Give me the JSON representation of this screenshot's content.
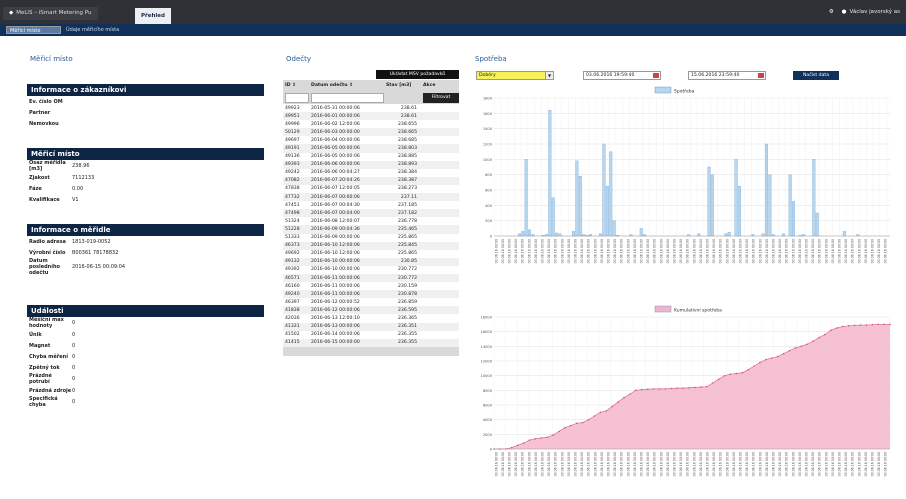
{
  "topbar": {
    "app_title": "MeLiS – iSmart Metering Pu",
    "active_tab": "Přehled",
    "user": "Václav javorský as"
  },
  "subbar": {
    "crumbs": [
      "Měřicí místo",
      "Údaje měřicího místa"
    ]
  },
  "left": {
    "title": "Měřicí místo",
    "boxes": [
      {
        "header": "Informace o zákazníkovi",
        "rows": [
          {
            "k": "Ev. číslo OM",
            "v": ""
          },
          {
            "k": "Partner",
            "v": ""
          },
          {
            "k": "Nemovkou",
            "v": ""
          }
        ]
      },
      {
        "header": "Měřicí místo",
        "rows": [
          {
            "k": "Osaz měřidla [m3]",
            "v": "238.96"
          },
          {
            "k": "Zjakost",
            "v": "7112133"
          },
          {
            "k": "Fáze",
            "v": "0.00"
          },
          {
            "k": "Kvalifikace",
            "v": "V1"
          }
        ]
      },
      {
        "header": "Informace o měřidle",
        "rows": [
          {
            "k": "Radio adresa",
            "v": "1813-019-0052"
          },
          {
            "k": "Výrobní číslo",
            "v": "B00361 78178832"
          },
          {
            "k": "Datum posledního odečtu",
            "v": "2016-06-15 00:09:04"
          }
        ]
      },
      {
        "header": "Události",
        "rows": [
          {
            "k": "Měšiční max hodnoty",
            "v": "0"
          },
          {
            "k": "Únik",
            "v": "0"
          },
          {
            "k": "Magnet",
            "v": "0"
          },
          {
            "k": "Chyba měření",
            "v": "0"
          },
          {
            "k": "Zpětný tok",
            "v": "0"
          },
          {
            "k": "Prázdné potrubí",
            "v": "0"
          },
          {
            "k": "Prázdná zdroje",
            "v": "0"
          },
          {
            "k": "Specifická chyba",
            "v": "0"
          }
        ]
      }
    ]
  },
  "table": {
    "title": "Odečty",
    "collapse_label": "Ukládat MSV požadavků",
    "headers": [
      "ID ⇕",
      "Datum odečtu ⇕",
      "Stav [m3]",
      "Akce"
    ],
    "filter_button": "Filtrovat",
    "rows": [
      [
        "49923",
        "2016-05-31 00:00:06",
        "238.61"
      ],
      [
        "49951",
        "2016-06-01 00:00:06",
        "238.61"
      ],
      [
        "49996",
        "2016-06-02 12:00:06",
        "238.655"
      ],
      [
        "50129",
        "2016-06-03 00:00:00",
        "238.665"
      ],
      [
        "49697",
        "2016-06-04 00:00:06",
        "238.685"
      ],
      [
        "49191",
        "2016-06-05 00:00:06",
        "238.803"
      ],
      [
        "49136",
        "2016-06-05 00:00:06",
        "238.885"
      ],
      [
        "49393",
        "2016-06-06 00:00:06",
        "238.893"
      ],
      [
        "49242",
        "2016-06-06 00:04:27",
        "238.384"
      ],
      [
        "47082",
        "2016-06-07 20:04:26",
        "238.387"
      ],
      [
        "47838",
        "2016-06-07 12:00:05",
        "238.273"
      ],
      [
        "47732",
        "2016-06-07 00:00:06",
        "237.11"
      ],
      [
        "47451",
        "2016-06-07 00:04:30",
        "237.185"
      ],
      [
        "47498",
        "2016-06-07 00:04:00",
        "237.182"
      ],
      [
        "51324",
        "2016-06-08 12:00:07",
        "236.778"
      ],
      [
        "51228",
        "2016-06-09 00:04:36",
        "235.465"
      ],
      [
        "51333",
        "2016-06-09 00:00:06",
        "235.865"
      ],
      [
        "46373",
        "2016-06-10 12:00:06",
        "235.845"
      ],
      [
        "49692",
        "2016-06-10 12:00:06",
        "235.865"
      ],
      [
        "49132",
        "2016-06-10 00:00:06",
        "230.85"
      ],
      [
        "49392",
        "2016-06-10 00:00:06",
        "230.772"
      ],
      [
        "46571",
        "2016-06-11 00:00:06",
        "230.772"
      ],
      [
        "46160",
        "2016-06-11 00:00:06",
        "230.159"
      ],
      [
        "49240",
        "2016-06-11 00:00:06",
        "230.878"
      ],
      [
        "46397",
        "2016-06-12 00:00:52",
        "236.859"
      ],
      [
        "41838",
        "2016-06-12 00:00:06",
        "236.595"
      ],
      [
        "42036",
        "2016-06-13 12:00:10",
        "236.365"
      ],
      [
        "41331",
        "2016-06-13 00:00:06",
        "236.351"
      ],
      [
        "41502",
        "2016-06-14 00:00:06",
        "236.355"
      ],
      [
        "41415",
        "2016-06-15 00:00:00",
        "236.355"
      ]
    ]
  },
  "consumption": {
    "title": "Spotřeba",
    "select_value": "Dobéry",
    "date_from": "03.06.2016 19:59:40",
    "date_to": "15.06.2016 23:59:40",
    "show_button": "Načíst data",
    "chart_data": [
      {
        "type": "bar",
        "legend": "Spotřeba",
        "color": "#b9d6ef",
        "ylim": [
          0,
          1800
        ],
        "yticks": [
          0,
          200,
          400,
          600,
          800,
          1000,
          1200,
          1400,
          1600,
          1800
        ],
        "values": [
          0,
          0,
          0,
          0,
          0,
          0,
          0,
          30,
          60,
          1000,
          80,
          20,
          0,
          0,
          10,
          20,
          1640,
          500,
          40,
          30,
          0,
          0,
          0,
          60,
          980,
          780,
          20,
          10,
          20,
          0,
          0,
          30,
          1200,
          650,
          1100,
          200,
          10,
          0,
          0,
          0,
          20,
          0,
          0,
          100,
          20,
          0,
          0,
          0,
          0,
          0,
          0,
          0,
          0,
          0,
          0,
          0,
          0,
          20,
          0,
          0,
          30,
          0,
          0,
          900,
          800,
          0,
          0,
          0,
          30,
          50,
          0,
          1000,
          650,
          0,
          0,
          0,
          20,
          0,
          0,
          30,
          1200,
          800,
          20,
          0,
          0,
          30,
          0,
          800,
          450,
          0,
          10,
          20,
          0,
          0,
          1000,
          300,
          0,
          0,
          0,
          0,
          0,
          0,
          0,
          60,
          0,
          0,
          0,
          20,
          0,
          0,
          0,
          0,
          0,
          0,
          0,
          0,
          0
        ]
      },
      {
        "type": "area",
        "legend": "Kumulativní spotřeba",
        "color": "#f4b3c8",
        "ylim": [
          0,
          18000
        ],
        "yticks": [
          0,
          2000,
          4000,
          6000,
          8000,
          10000,
          12000,
          14000,
          16000,
          18000
        ],
        "values": [
          0,
          0,
          0,
          200,
          500,
          800,
          1200,
          1400,
          1500,
          1600,
          1900,
          2400,
          2900,
          3200,
          3500,
          3600,
          4000,
          4500,
          5000,
          5200,
          5800,
          6400,
          7000,
          7500,
          8000,
          8100,
          8150,
          8200,
          8200,
          8200,
          8250,
          8300,
          8300,
          8350,
          8400,
          8450,
          8500,
          9000,
          9500,
          10000,
          10200,
          10300,
          10400,
          10800,
          11300,
          11800,
          12200,
          12400,
          12600,
          13000,
          13400,
          13800,
          14000,
          14300,
          14700,
          15200,
          15600,
          16200,
          16500,
          16700,
          16800,
          16850,
          16900,
          16900,
          16950,
          17000,
          17000,
          17000
        ]
      }
    ],
    "x_tick_label": "03.06.16 00:00"
  }
}
